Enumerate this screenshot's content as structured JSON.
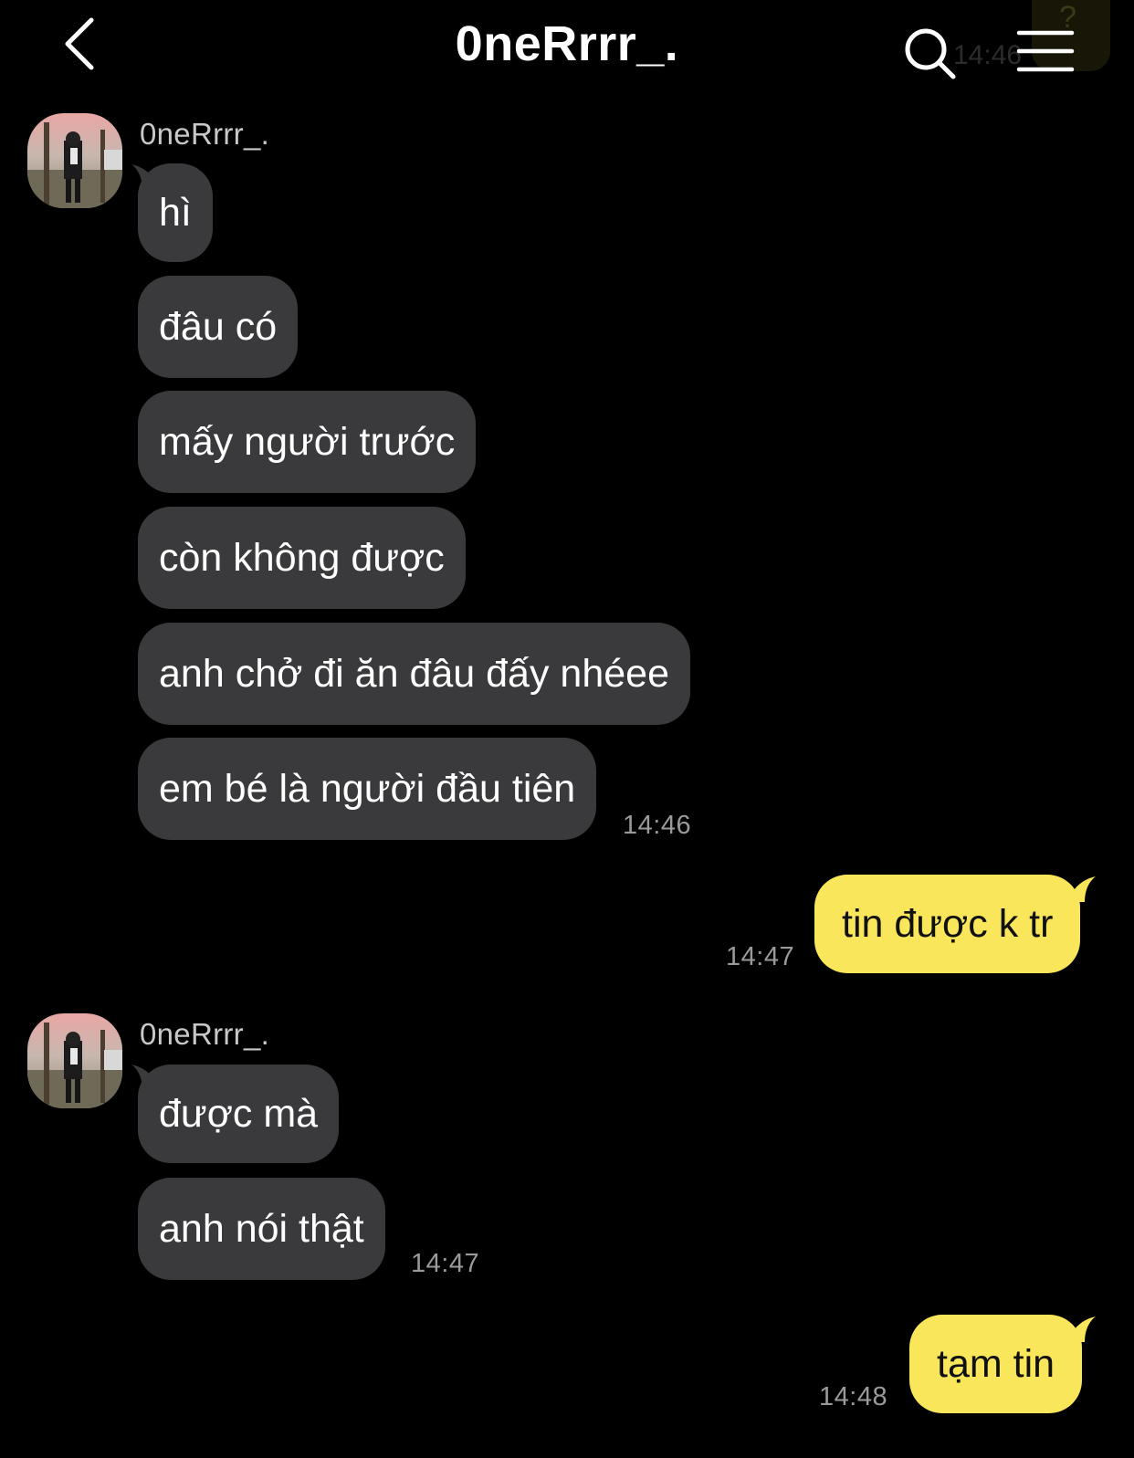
{
  "header": {
    "title": "0neRrrr_.",
    "back_icon": "chevron-left-icon",
    "search_icon": "search-icon",
    "menu_icon": "hamburger-menu-icon",
    "ghost_time": "14:46",
    "ghost_symbol": "?"
  },
  "colors": {
    "background": "#000000",
    "incoming_bubble": "#3a3a3c",
    "outgoing_bubble": "#fae65a",
    "timestamp": "#9a9a9a"
  },
  "messages": {
    "group1": {
      "sender": "0neRrrr_.",
      "items": [
        "hì",
        "đâu có",
        "mấy người trước",
        "còn không được",
        "anh chở đi ăn đâu đấy nhéee",
        "em bé là người đầu tiên"
      ],
      "time": "14:46"
    },
    "reply1": {
      "text": "tin được k tr",
      "time": "14:47"
    },
    "group2": {
      "sender": "0neRrrr_.",
      "items": [
        "được mà",
        "anh nói thật"
      ],
      "time": "14:47"
    },
    "reply2": {
      "text": "tạm tin",
      "time": "14:48"
    }
  }
}
